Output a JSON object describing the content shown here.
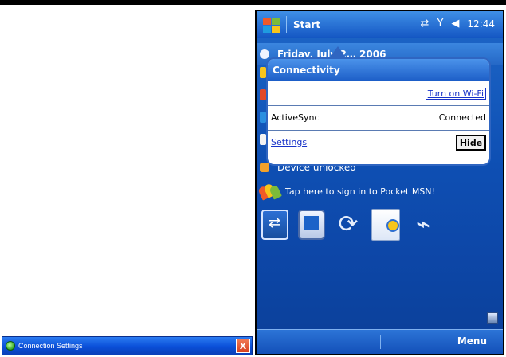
{
  "left_window": {
    "title": "Connection Settings",
    "close_label": "X"
  },
  "device": {
    "nav": {
      "start_label": "Start",
      "clock": "12:44",
      "icons": [
        "windows-flag-icon",
        "connectivity-icon",
        "signal-antenna-icon",
        "speaker-icon"
      ]
    },
    "today": {
      "date_text": "Friday, July 2… 2006",
      "device_status": "Device unlocked",
      "msn_prompt": "Tap here to sign in to Pocket MSN!"
    },
    "popup": {
      "title": "Connectivity",
      "wifi_link": "Turn on Wi-Fi",
      "activesync_label": "ActiveSync",
      "activesync_status": "Connected",
      "settings_link": "Settings",
      "hide_label": "Hide"
    },
    "softkeys": {
      "right": "Menu"
    }
  },
  "colors": {
    "accent_blue": "#1456c3",
    "link_blue": "#1732c9",
    "titlebar_blue": "#0a4fd8",
    "close_red": "#d8401f"
  }
}
